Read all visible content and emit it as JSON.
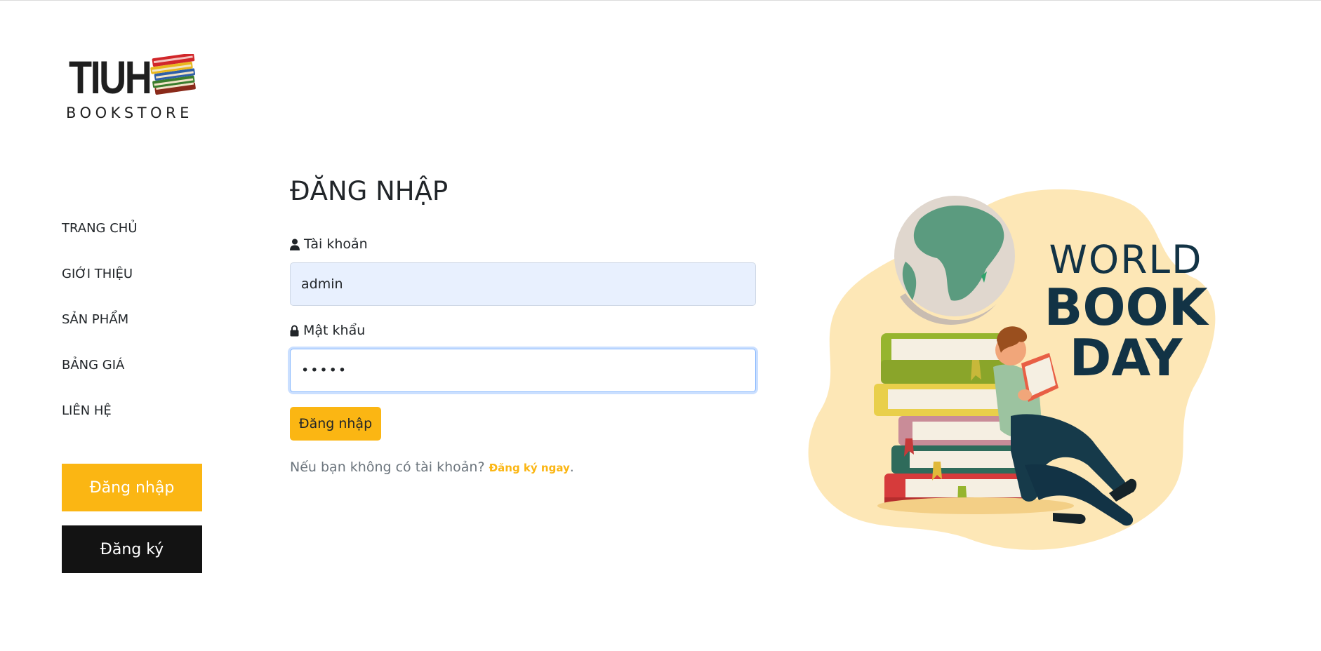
{
  "logo": {
    "brand": "TIUH",
    "subtitle": "BOOKSTORE"
  },
  "nav": {
    "items": [
      {
        "label": "TRANG CHỦ"
      },
      {
        "label": "GIỚI THIỆU"
      },
      {
        "label": "SẢN PHẨM"
      },
      {
        "label": "BẢNG GIÁ"
      },
      {
        "label": "LIÊN HỆ"
      }
    ],
    "login_label": "Đăng nhập",
    "register_label": "Đăng ký"
  },
  "form": {
    "title": "ĐĂNG NHẬP",
    "username_label": "Tài khoản",
    "username_value": "admin",
    "password_label": "Mật khẩu",
    "password_value": "•••••",
    "submit_label": "Đăng nhập",
    "register_prompt": "Nếu bạn không có tài khoản?",
    "register_link": "Đăng ký ngay",
    "register_suffix": "."
  },
  "illustration": {
    "line1": "WORLD",
    "line2": "BOOK",
    "line3": "DAY"
  },
  "colors": {
    "accent": "#fbb613",
    "dark": "#131313",
    "input_filled": "#e8f0fe",
    "title_navy": "#123345"
  }
}
